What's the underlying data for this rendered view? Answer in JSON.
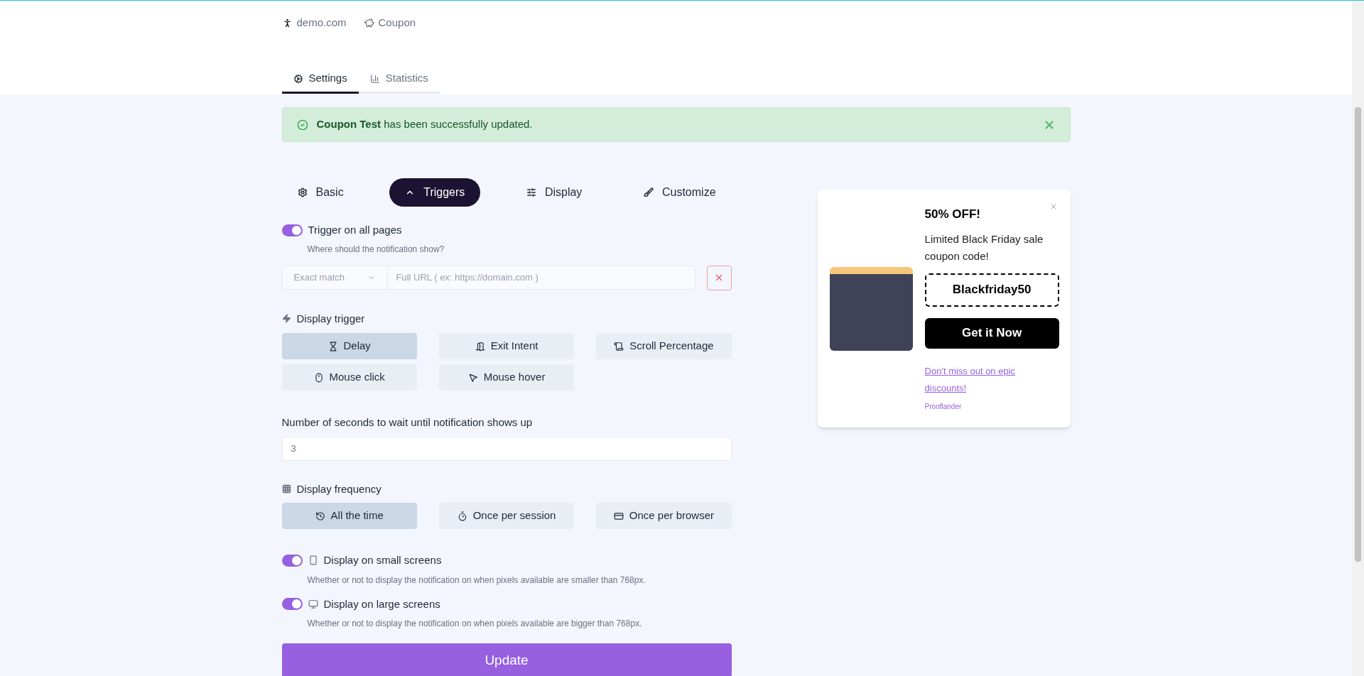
{
  "header": {
    "meta": [
      {
        "kind": "site",
        "label": "demo.com"
      },
      {
        "kind": "type",
        "label": "Coupon"
      }
    ]
  },
  "tabs": [
    {
      "label": "Settings",
      "selected": true
    },
    {
      "label": "Statistics",
      "selected": false
    }
  ],
  "alert": {
    "message": "**Coupon Test** has been successfully updated."
  },
  "section_tabs": [
    {
      "label": "Basic",
      "selected": false
    },
    {
      "label": "Triggers",
      "selected": true
    },
    {
      "label": "Display",
      "selected": false
    },
    {
      "label": "Customize",
      "selected": false
    }
  ],
  "trigger_all_pages": {
    "label": "Trigger on all pages",
    "on": true,
    "hint": "Where should the notification show?"
  },
  "url_rule": {
    "match": "Exact match",
    "placeholder": "Full URL ( ex: https://domain.com )"
  },
  "display_trigger": {
    "label": "Display trigger",
    "options": [
      {
        "label": "Delay",
        "selected": true
      },
      {
        "label": "Exit Intent",
        "selected": false
      },
      {
        "label": "Scroll Percentage",
        "selected": false
      },
      {
        "label": "Mouse click",
        "selected": false
      },
      {
        "label": "Mouse hover",
        "selected": false
      }
    ]
  },
  "delay": {
    "label": "Number of seconds to wait until notification shows up",
    "value": "3"
  },
  "display_frequency": {
    "label": "Display frequency",
    "options": [
      {
        "label": "All the time",
        "selected": true
      },
      {
        "label": "Once per session",
        "selected": false
      },
      {
        "label": "Once per browser",
        "selected": false
      }
    ]
  },
  "screens": [
    {
      "kind": "small",
      "label": "Display on small screens",
      "on": true,
      "hint": "Whether or not to display the notification on when pixels available are smaller than 768px."
    },
    {
      "kind": "large",
      "label": "Display on large screens",
      "on": true,
      "hint": "Whether or not to display the notification on when pixels available are bigger than 768px."
    }
  ],
  "update_button": "Update",
  "preview": {
    "title": "50% OFF!",
    "description": "Limited Black Friday sale coupon code!",
    "code": "Blackfriday50",
    "button": "Get it Now",
    "link": "Don't miss out on epic discounts!",
    "brand": "Prooflander"
  }
}
